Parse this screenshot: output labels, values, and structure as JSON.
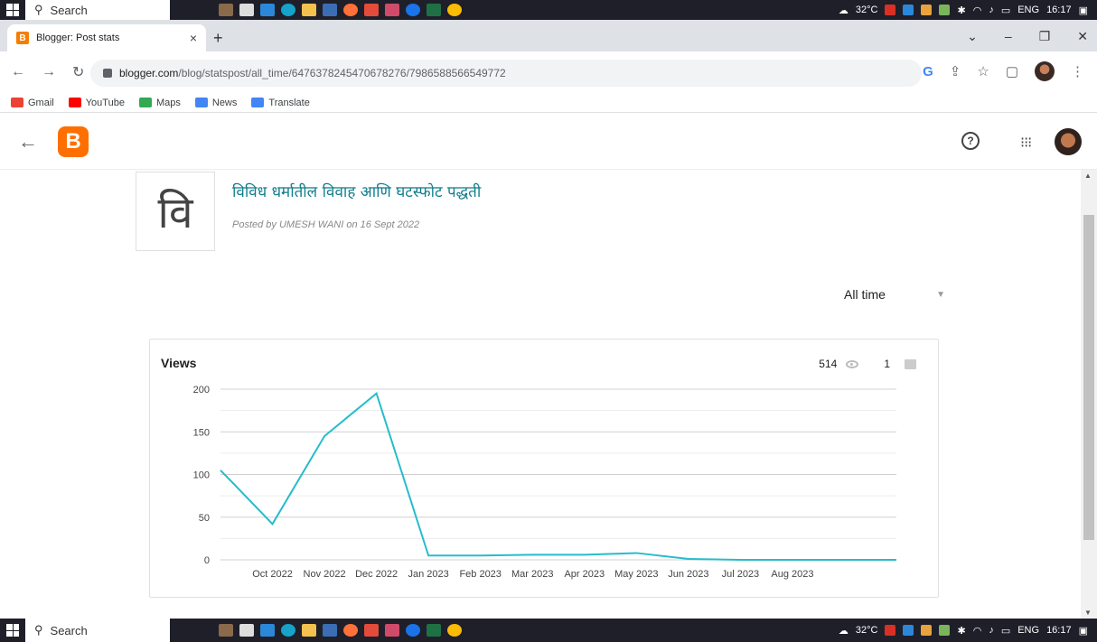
{
  "taskbar": {
    "search_label": "Search",
    "weather": "32°C",
    "language": "ENG",
    "time": "16:17"
  },
  "browser": {
    "tab_title": "Blogger: Post stats",
    "favicon_letter": "B",
    "url_host": "blogger.com",
    "url_path": "/blog/statspost/all_time/6476378245470678276/7986588566549772",
    "bookmarks": [
      {
        "label": "Gmail",
        "color": "#ea4335"
      },
      {
        "label": "YouTube",
        "color": "#ff0000"
      },
      {
        "label": "Maps",
        "color": "#34a853"
      },
      {
        "label": "News",
        "color": "#4285f4"
      },
      {
        "label": "Translate",
        "color": "#4285f4"
      }
    ]
  },
  "app": {
    "logo_letter": "B",
    "help_icon_glyph": "?",
    "apps_icon_glyph": "⁝⁝⁝"
  },
  "post": {
    "thumb_char": "वि",
    "title": "विविध धर्मातील विवाह आणि घटस्फोट पद्धती",
    "meta": "Posted by UMESH WANI on 16 Sept 2022"
  },
  "range": {
    "selected": "All time"
  },
  "stats": {
    "card_title": "Views",
    "views_total": "514",
    "comments_total": "1"
  },
  "colors": {
    "line": "#26bccd",
    "title": "#0f7c8c",
    "logo": "#ff6f00"
  },
  "chart_data": {
    "type": "line",
    "title": "Views",
    "x_labels": [
      "Oct 2022",
      "Nov 2022",
      "Dec 2022",
      "Jan 2023",
      "Feb 2023",
      "Mar 2023",
      "Apr 2023",
      "May 2023",
      "Jun 2023",
      "Jul 2023",
      "Aug 2023"
    ],
    "x": [
      0,
      1,
      2,
      3,
      4,
      5,
      6,
      7,
      8,
      9,
      10,
      11,
      12,
      13
    ],
    "values": [
      105,
      42,
      145,
      195,
      5,
      5,
      6,
      6,
      8,
      1,
      0,
      0,
      0,
      0
    ],
    "ylim": [
      0,
      200
    ],
    "yticks": [
      0,
      50,
      100,
      150,
      200
    ],
    "grid": true
  }
}
